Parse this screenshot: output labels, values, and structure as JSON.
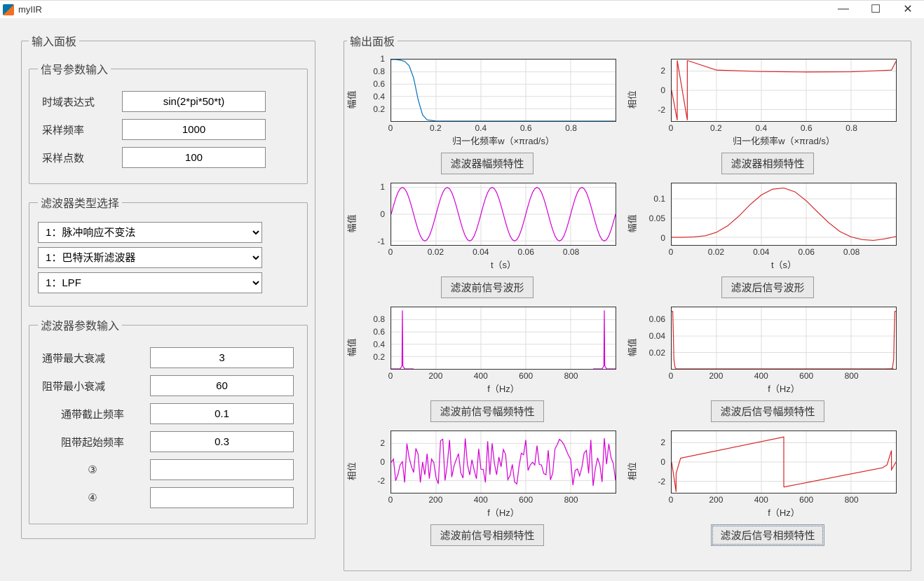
{
  "window": {
    "title": "myIIR"
  },
  "input_panel": {
    "title": "输入面板",
    "signal_group": {
      "title": "信号参数输入",
      "expr_label": "时域表达式",
      "expr_value": "sin(2*pi*50*t)",
      "fs_label": "采样频率",
      "fs_value": "1000",
      "n_label": "采样点数",
      "n_value": "100"
    },
    "type_group": {
      "title": "滤波器类型选择",
      "dd1": "1：脉冲响应不变法",
      "dd2": "1：巴特沃斯滤波器",
      "dd3": "1：LPF"
    },
    "param_group": {
      "title": "滤波器参数输入",
      "p1_label": "通带最大衰减",
      "p1_value": "3",
      "p2_label": "阻带最小衰减",
      "p2_value": "60",
      "p3_label": "通带截止频率",
      "p3_value": "0.1",
      "p4_label": "阻带起始频率",
      "p4_value": "0.3",
      "p5_label": "③",
      "p5_value": "",
      "p6_label": "④",
      "p6_value": ""
    }
  },
  "output_panel": {
    "title": "输出面板",
    "buttons": {
      "b1": "滤波器幅频特性",
      "b2": "滤波器相频特性",
      "b3": "滤波前信号波形",
      "b4": "滤波后信号波形",
      "b5": "滤波前信号幅频特性",
      "b6": "滤波后信号幅频特性",
      "b7": "滤波前信号相频特性",
      "b8": "滤波后信号相频特性"
    }
  },
  "colors": {
    "blue": "#0072bd",
    "red": "#d62728",
    "magenta": "#d400d4"
  },
  "chart_data": [
    {
      "id": "p1",
      "type": "line",
      "color": "blue",
      "title_btn": "b1",
      "xlabel": "归一化频率w（×πrad/s）",
      "ylabel": "幅值",
      "xticks": [
        0,
        0.2,
        0.4,
        0.6,
        0.8
      ],
      "xlim": [
        0,
        1
      ],
      "yticks": [
        0.2,
        0.4,
        0.6,
        0.8,
        1
      ],
      "ylim": [
        0,
        1
      ],
      "x": [
        0,
        0.02,
        0.04,
        0.06,
        0.08,
        0.1,
        0.12,
        0.14,
        0.16,
        0.2,
        0.3,
        1.0
      ],
      "y": [
        1,
        1,
        0.99,
        0.97,
        0.9,
        0.7,
        0.35,
        0.1,
        0.02,
        0,
        0,
        0
      ]
    },
    {
      "id": "p2",
      "type": "line",
      "color": "red",
      "title_btn": "b2",
      "xlabel": "归一化频率w（×πrad/s）",
      "ylabel": "相位",
      "xticks": [
        0,
        0.2,
        0.4,
        0.6,
        0.8
      ],
      "xlim": [
        0,
        1
      ],
      "yticks": [
        -2,
        0,
        2
      ],
      "ylim": [
        -3.2,
        3.2
      ],
      "segments": [
        {
          "x": [
            0,
            0.025,
            0.025
          ],
          "y": [
            0,
            -3.1,
            3.1
          ]
        },
        {
          "x": [
            0.025,
            0.07,
            0.07
          ],
          "y": [
            3.1,
            -3.1,
            3.1
          ]
        },
        {
          "x": [
            0.07,
            0.2,
            0.4,
            0.6,
            0.8,
            0.98,
            1.0
          ],
          "y": [
            3.1,
            2.1,
            1.95,
            1.9,
            1.92,
            2.1,
            3.0
          ]
        }
      ]
    },
    {
      "id": "p3",
      "type": "line",
      "color": "magenta",
      "title_btn": "b3",
      "xlabel": "t（s）",
      "ylabel": "幅值",
      "xticks": [
        0,
        0.02,
        0.04,
        0.06,
        0.08
      ],
      "xlim": [
        0,
        0.1
      ],
      "yticks": [
        -1,
        0,
        1
      ],
      "ylim": [
        -1.15,
        1.15
      ],
      "sine": {
        "amp": 1,
        "freq": 50,
        "n": 100
      }
    },
    {
      "id": "p4",
      "type": "line",
      "color": "red",
      "title_btn": "b4",
      "xlabel": "t（s）",
      "ylabel": "幅值",
      "xticks": [
        0,
        0.02,
        0.04,
        0.06,
        0.08
      ],
      "xlim": [
        0,
        0.1
      ],
      "yticks": [
        0,
        0.05,
        0.1
      ],
      "ylim": [
        -0.02,
        0.14
      ],
      "x": [
        0,
        0.005,
        0.01,
        0.015,
        0.02,
        0.025,
        0.03,
        0.035,
        0.04,
        0.045,
        0.05,
        0.055,
        0.06,
        0.065,
        0.07,
        0.075,
        0.08,
        0.085,
        0.09,
        0.095,
        0.1
      ],
      "y": [
        0,
        0,
        0.001,
        0.004,
        0.013,
        0.03,
        0.055,
        0.085,
        0.11,
        0.125,
        0.128,
        0.118,
        0.095,
        0.066,
        0.038,
        0.015,
        0.001,
        -0.006,
        -0.008,
        -0.004,
        0.002
      ]
    },
    {
      "id": "p5",
      "type": "line",
      "color": "magenta",
      "title_btn": "b5",
      "xlabel": "f（Hz）",
      "ylabel": "幅值",
      "xticks": [
        0,
        200,
        400,
        600,
        800
      ],
      "xlim": [
        0,
        1000
      ],
      "yticks": [
        0.2,
        0.4,
        0.6,
        0.8
      ],
      "ylim": [
        0,
        1
      ],
      "segments": [
        {
          "x": [
            0,
            40,
            48,
            50,
            52,
            60,
            100
          ],
          "y": [
            0,
            0,
            0.05,
            0.95,
            0.05,
            0,
            0
          ]
        },
        {
          "x": [
            900,
            940,
            948,
            950,
            952,
            960,
            1000
          ],
          "y": [
            0,
            0,
            0.05,
            0.95,
            0.05,
            0,
            0
          ]
        }
      ]
    },
    {
      "id": "p6",
      "type": "line",
      "color": "red",
      "title_btn": "b6",
      "xlabel": "f（Hz）",
      "ylabel": "幅值",
      "xticks": [
        0,
        200,
        400,
        600,
        800
      ],
      "xlim": [
        0,
        1000
      ],
      "yticks": [
        0.02,
        0.04,
        0.06
      ],
      "ylim": [
        0,
        0.075
      ],
      "segments": [
        {
          "x": [
            0,
            5,
            8,
            10,
            15,
            20,
            40,
            990
          ],
          "y": [
            0.07,
            0.07,
            0.04,
            0.012,
            0.002,
            0,
            0,
            0
          ]
        },
        {
          "x": [
            960,
            980,
            985,
            990,
            992,
            995,
            1000
          ],
          "y": [
            0,
            0,
            0.002,
            0.012,
            0.04,
            0.07,
            0.07
          ]
        }
      ]
    },
    {
      "id": "p7",
      "type": "line",
      "color": "magenta",
      "title_btn": "b7",
      "xlabel": "f（Hz）",
      "ylabel": "相位",
      "xticks": [
        0,
        200,
        400,
        600,
        800
      ],
      "xlim": [
        0,
        1000
      ],
      "yticks": [
        -2,
        0,
        2
      ],
      "ylim": [
        -3.3,
        3.3
      ],
      "noise": {
        "n": 100,
        "amp": 2.6
      }
    },
    {
      "id": "p8",
      "type": "line",
      "color": "red",
      "title_btn": "b8",
      "xlabel": "f（Hz）",
      "ylabel": "相位",
      "xticks": [
        0,
        200,
        400,
        600,
        800
      ],
      "xlim": [
        0,
        1000
      ],
      "yticks": [
        -2,
        0,
        2
      ],
      "ylim": [
        -3.2,
        3.2
      ],
      "segments": [
        {
          "x": [
            0,
            20,
            20,
            40,
            500,
            500
          ],
          "y": [
            0,
            -3.1,
            -1.2,
            0.4,
            2.6,
            -2.6
          ]
        },
        {
          "x": [
            500,
            940,
            960,
            980,
            980,
            1000
          ],
          "y": [
            -2.6,
            -0.6,
            -0.3,
            1.2,
            -0.8,
            0
          ]
        }
      ]
    }
  ]
}
